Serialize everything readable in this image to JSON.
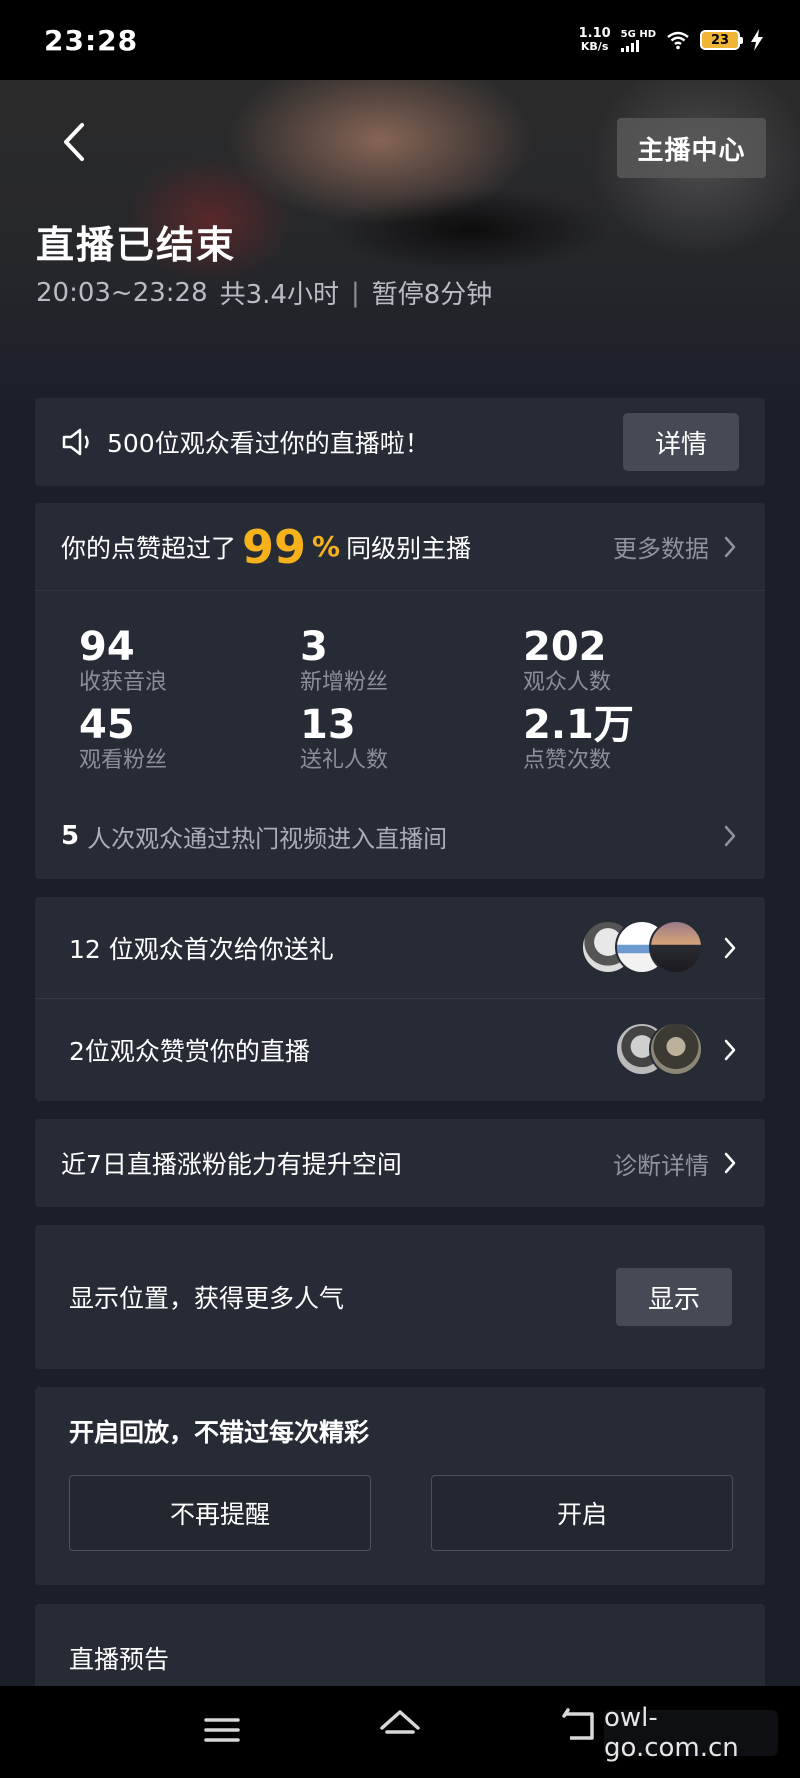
{
  "status_bar": {
    "time": "23:28",
    "net_speed_value": "1.10",
    "net_speed_unit": "KB/s",
    "signal_label": "5G HD",
    "battery_level": "23",
    "icons": [
      "signal-icon",
      "wifi-icon",
      "battery-icon",
      "charging-icon"
    ]
  },
  "header": {
    "anchor_center_label": "主播中心",
    "title": "直播已结束",
    "time_range": "20:03~23:28",
    "duration": "共3.4小时",
    "separator": "|",
    "paused": "暂停8分钟"
  },
  "notice": {
    "text": "500位观众看过你的直播啦！",
    "details_label": "详情"
  },
  "stats": {
    "head_prefix": "你的点赞超过了",
    "percent_value": "99",
    "percent_sign": "%",
    "head_suffix": "同级别主播",
    "more_data_label": "更多数据",
    "items": [
      {
        "value": "94",
        "label": "收获音浪"
      },
      {
        "value": "3",
        "label": "新增粉丝"
      },
      {
        "value": "202",
        "label": "观众人数"
      },
      {
        "value": "45",
        "label": "观看粉丝"
      },
      {
        "value": "13",
        "label": "送礼人数"
      },
      {
        "value": "2.1万",
        "label": "点赞次数"
      }
    ],
    "hot_count": "5",
    "hot_text": "人次观众通过热门视频进入直播间"
  },
  "gifts": {
    "first_gift_text": "12 位观众首次给你送礼",
    "reward_text": "2位观众赞赏你的直播"
  },
  "growth": {
    "text": "近7日直播涨粉能力有提升空间",
    "diagnose_label": "诊断详情"
  },
  "location": {
    "text": "显示位置，获得更多人气",
    "show_label": "显示"
  },
  "replay": {
    "title": "开启回放，不错过每次精彩",
    "dismiss_label": "不再提醒",
    "enable_label": "开启"
  },
  "preview": {
    "title": "直播预告"
  },
  "nav": {
    "icons": [
      "menu-icon",
      "home-icon",
      "back-icon"
    ]
  },
  "watermark": {
    "text": "owl-go.com.cn"
  },
  "colors": {
    "background": "#1b1f28",
    "card": "#262b35",
    "accent": "#f5b21c",
    "secondary_text": "#8a8f98"
  }
}
